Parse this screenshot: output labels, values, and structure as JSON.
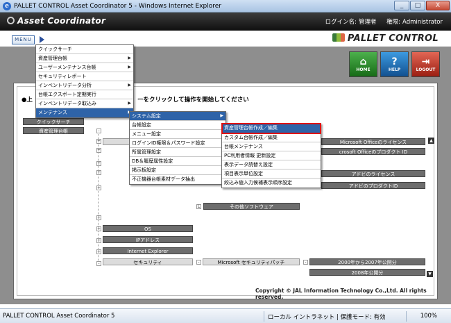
{
  "window": {
    "title": "PALLET CONTROL Asset Coordinator 5 - Windows Internet Explorer",
    "buttons": {
      "minimize": "_",
      "maximize": "□",
      "close": "X"
    }
  },
  "header": {
    "app_name": "Asset Coordinator",
    "login_label": "ログイン名:",
    "login_value": "管理者",
    "role_label": "権限:",
    "role_value": "Administrator"
  },
  "menubar": {
    "menu_label": "MENU",
    "brand": "PALLET CONTROL"
  },
  "nav_buttons": [
    {
      "label": "HOME",
      "glyph": "⌂"
    },
    {
      "label": "HELP",
      "glyph": "?"
    },
    {
      "label": "LOGOUT",
      "glyph": "⇥"
    }
  ],
  "instruction": {
    "bullet": "●上",
    "text": "ーをクリックして操作を開始してください"
  },
  "main_menu": [
    {
      "label": "クイックサーチ",
      "has_sub": false
    },
    {
      "label": "資産管理台帳",
      "has_sub": true
    },
    {
      "label": "ユーザーメンテナンス台帳",
      "has_sub": true
    },
    {
      "label": "セキュリティレポート",
      "has_sub": false
    },
    {
      "label": "インベントリデータ分析",
      "has_sub": true
    },
    {
      "label": "台帳エクスポート定期実行",
      "has_sub": false
    },
    {
      "label": "インベントリデータ取込み",
      "has_sub": true
    },
    {
      "label": "メンテナンス",
      "has_sub": true,
      "active": true
    }
  ],
  "sub_menu": [
    {
      "label": "システム設定",
      "has_sub": true,
      "active": true
    },
    {
      "label": "台帳設定",
      "has_sub": false
    },
    {
      "label": "メニュー設定",
      "has_sub": false
    },
    {
      "label": "ログインID権限＆パスワード設定",
      "has_sub": false
    },
    {
      "label": "所属管理設定",
      "has_sub": false
    },
    {
      "label": "DB＆履歴属性設定",
      "has_sub": false
    },
    {
      "label": "掲示板設定",
      "has_sub": false
    },
    {
      "label": "不正機器台帳素材データ抽出",
      "has_sub": false
    }
  ],
  "sub_sub_menu": [
    {
      "label": "資産管理台帳作成／編集",
      "highlighted": true
    },
    {
      "label": "カスタム台帳作成／編集"
    },
    {
      "label": "台帳メンテナンス"
    },
    {
      "label": "PC利用者情報 更新設定"
    },
    {
      "label": "表示データ読替え設定"
    },
    {
      "label": "項目表示単位設定"
    },
    {
      "label": "絞込み値入力候補表示順序設定"
    }
  ],
  "tree": {
    "quick_search": "クイックサーチ",
    "asset_ledger": "資産管理台帳",
    "ms_office_license": "Microsoft Officeのライセンス",
    "ms_office_product_id": "crosoft Officeのプロダクト ID",
    "adobe_license": "アドビのライセンス",
    "adobe_product_id": "アドビのプロダクトID",
    "other_software": "その他ソフトウェア",
    "os": "OS",
    "ip_address": "IPアドレス",
    "ie": "Internet Explorer",
    "security": "セキュリティ",
    "ms_patch": "Microsoft セキュリティパッチ",
    "patch_2000_2007": "2000年から2007年公開分",
    "patch_2008": "2008年公開分"
  },
  "copyright": "Copyright  ©  JAL Information Technology Co.,Ltd. All rights reserved.",
  "statusbar": {
    "left": "PALLET CONTROL Asset Coordinator 5",
    "zone": "ローカル イントラネット | 保護モード: 有効",
    "zoom": "100%"
  }
}
